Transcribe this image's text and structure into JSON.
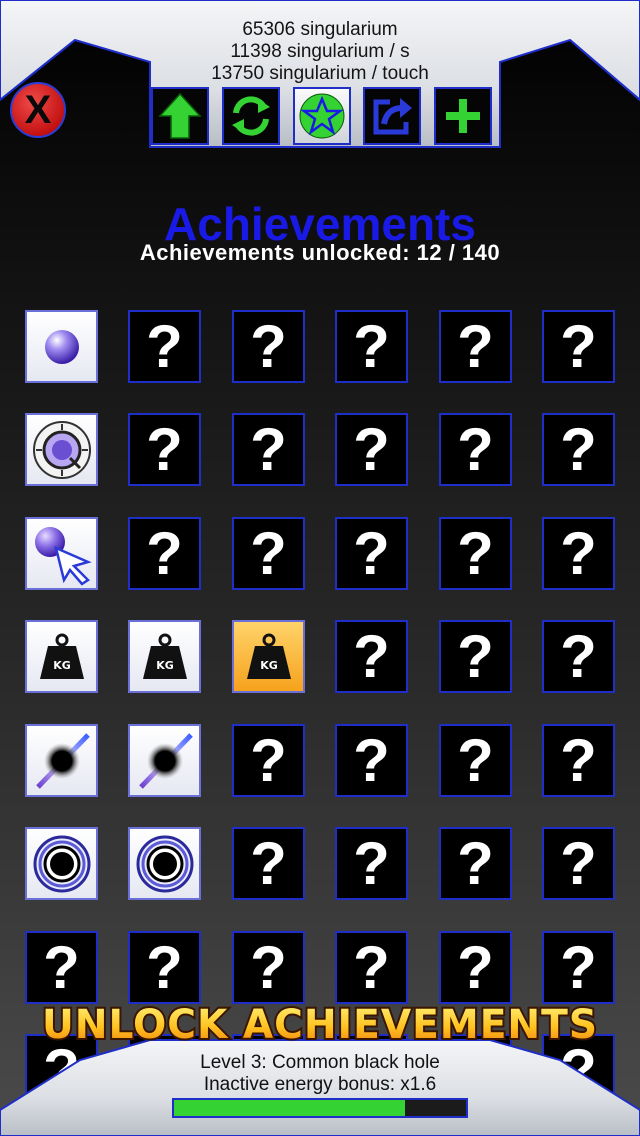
{
  "header": {
    "stats": [
      "65306 singularium",
      "11398 singularium / s",
      "13750 singularium / touch"
    ],
    "close_label": "X"
  },
  "toolbar": {
    "buttons": [
      {
        "icon": "arrow-up-icon",
        "active": false
      },
      {
        "icon": "refresh-icon",
        "active": false
      },
      {
        "icon": "star-icon",
        "active": true
      },
      {
        "icon": "share-icon",
        "active": false
      },
      {
        "icon": "plus-icon",
        "active": false
      }
    ]
  },
  "achievements": {
    "title": "Achievements",
    "unlocked_label": "Achievements unlocked: 12 / 140",
    "unlocked_count": 12,
    "total": 140
  },
  "grid": {
    "columns": 6,
    "rows": [
      [
        "sphere-icon",
        "?",
        "?",
        "?",
        "?",
        "?"
      ],
      [
        "clock-icon",
        "?",
        "?",
        "?",
        "?",
        "?"
      ],
      [
        "cursor-icon",
        "?",
        "?",
        "?",
        "?",
        "?"
      ],
      [
        "weight-icon",
        "weight-icon",
        "weight-gold-icon",
        "?",
        "?",
        "?"
      ],
      [
        "black-hole-jet-icon",
        "black-hole-jet-icon",
        "?",
        "?",
        "?",
        "?"
      ],
      [
        "black-hole-ring-icon",
        "black-hole-ring-icon",
        "?",
        "?",
        "?",
        "?"
      ],
      [
        "?",
        "?",
        "?",
        "?",
        "?",
        "?"
      ],
      [
        "?",
        "?",
        "?",
        "?",
        "?",
        "?"
      ]
    ],
    "weight_label": "KG",
    "locked_symbol": "?"
  },
  "banner": {
    "text": "UNLOCK ACHIEVEMENTS"
  },
  "footer": {
    "level": "Level 3: Common black hole",
    "bonus": "Inactive energy bonus: x1.6",
    "progress": 0.79
  },
  "colors": {
    "accent_blue": "#1f2ec9",
    "title_blue": "#1a1ae6",
    "progress_green": "#35d233",
    "close_red": "#c41212",
    "gold": "#f6a21c"
  }
}
